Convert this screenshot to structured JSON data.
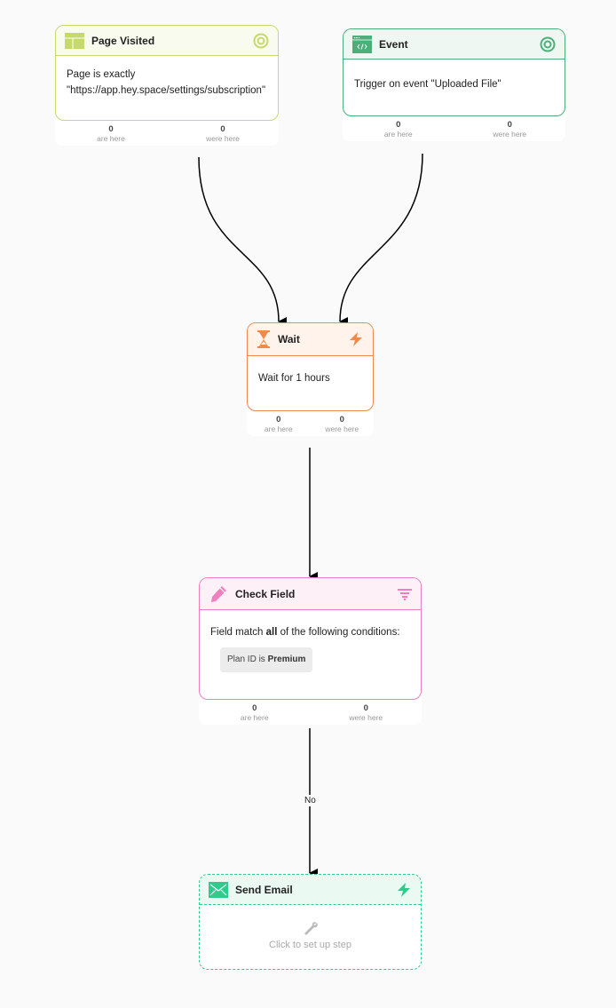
{
  "nodes": {
    "page_visited": {
      "title": "Page Visited",
      "icon": "layout-icon",
      "status_icon": "target-icon",
      "body_line1": "Page is exactly",
      "body_line2": "\"https://app.hey.space/settings/subscription\"",
      "stats": {
        "are_here_count": "0",
        "are_here_label": "are here",
        "were_here_count": "0",
        "were_here_label": "were here"
      },
      "color": "#c6d96b",
      "head_bg": "#f8fbee"
    },
    "event": {
      "title": "Event",
      "icon": "code-window-icon",
      "status_icon": "target-icon",
      "body": "Trigger on event \"Uploaded File\"",
      "stats": {
        "are_here_count": "0",
        "are_here_label": "are here",
        "were_here_count": "0",
        "were_here_label": "were here"
      },
      "color": "#4caf7a",
      "head_bg": "#eef7f1"
    },
    "wait": {
      "title": "Wait",
      "icon": "hourglass-icon",
      "status_icon": "lightning-icon",
      "body": "Wait for 1 hours",
      "stats": {
        "are_here_count": "0",
        "are_here_label": "are here",
        "were_here_count": "0",
        "were_here_label": "were here"
      },
      "color": "#f08a4b",
      "head_bg": "#fff3ec"
    },
    "check_field": {
      "title": "Check Field",
      "icon": "pencil-icon",
      "status_icon": "filter-icon",
      "body_prefix": "Field match ",
      "body_bold": "all",
      "body_suffix": " of the following conditions:",
      "condition_prefix": "Plan ID is ",
      "condition_value": "Premium",
      "stats": {
        "are_here_count": "0",
        "are_here_label": "are here",
        "were_here_count": "0",
        "were_here_label": "were here"
      },
      "color": "#f07fc0",
      "head_bg": "#fdf0f7"
    },
    "send_email": {
      "title": "Send Email",
      "icon": "envelope-icon",
      "status_icon": "lightning-icon",
      "placeholder_icon": "wrench-icon",
      "placeholder": "Click to set up step",
      "color": "#2dcc8a",
      "head_bg": "#eafaf2"
    }
  },
  "edges": [
    {
      "from": "page_visited",
      "to": "wait"
    },
    {
      "from": "event",
      "to": "wait"
    },
    {
      "from": "wait",
      "to": "check_field"
    },
    {
      "from": "check_field",
      "to": "send_email",
      "label": "No"
    }
  ]
}
